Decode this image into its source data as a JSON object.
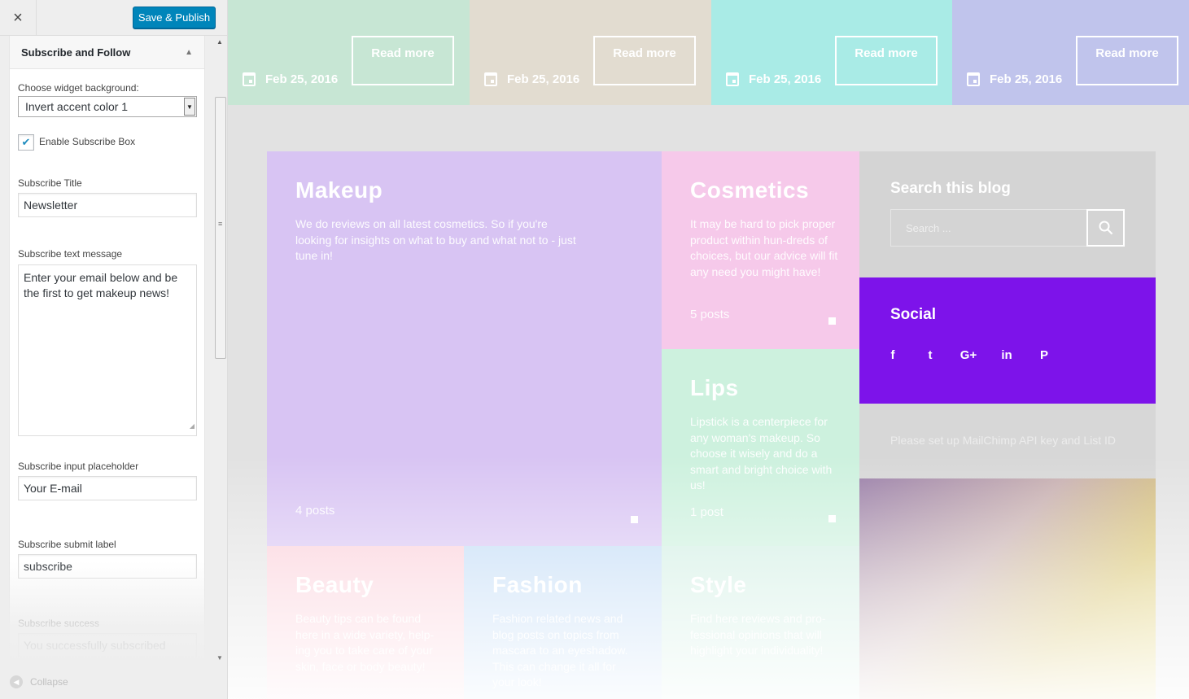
{
  "customizer": {
    "close_label": "×",
    "save_label": "Save & Publish",
    "section_title": "Subscribe and Follow",
    "section_arrow": "▲",
    "widget_background_label": "Choose widget background:",
    "widget_background_value": "Invert accent color 1",
    "enable_subscribe_label": "Enable Subscribe Box",
    "enable_subscribe_checked": true,
    "subscribe_title_label": "Subscribe Title",
    "subscribe_title_value": "Newsletter",
    "subscribe_text_label": "Subscribe text message",
    "subscribe_text_value": "Enter your email below and be the first to get makeup news!",
    "placeholder_label": "Subscribe input placeholder",
    "placeholder_value": "Your E-mail",
    "submit_label_label": "Subscribe submit label",
    "submit_label_value": "subscribe",
    "success_label": "Subscribe success",
    "success_value": "You successfully subscribed",
    "collapse_label": "Collapse"
  },
  "preview": {
    "top_posts": [
      {
        "date": "Feb 25, 2016",
        "button": "Read more",
        "color": "#c7e6d4"
      },
      {
        "date": "Feb 25, 2016",
        "button": "Read more",
        "color": "#e2dcd0"
      },
      {
        "date": "Feb 25, 2016",
        "button": "Read more",
        "color": "#a9ebe6"
      },
      {
        "date": "Feb 25, 2016",
        "button": "Read more",
        "color": "#c0c4ec"
      }
    ],
    "categories": {
      "makeup": {
        "title": "Makeup",
        "desc": "We do reviews on all latest cosmetics. So if you're looking for insights on what to buy and what not to - just tune in!",
        "count": "4 posts",
        "color": "#d8c4f3"
      },
      "cosmetics": {
        "title": "Cosmetics",
        "desc": "It may be hard to pick proper product within hun-dreds of choices, but our advice will fit any need you might have!",
        "count": "5 posts",
        "color": "#f6c9ea"
      },
      "lips": {
        "title": "Lips",
        "desc": "Lipstick is a centerpiece for any woman's makeup. So choose it wisely and do a smart and bright choice with us!",
        "count": "1 post",
        "color": "#cdf1de"
      },
      "beauty": {
        "title": "Beauty",
        "desc": "Beauty tips can be found here in a wide variety, help-ing you to take care of your skin, face or body beauty!",
        "color": "#fbd0da"
      },
      "fashion": {
        "title": "Fashion",
        "desc": "Fashion related news and blog posts on topics from mascara to an eyeshadow. This can change it all for your look!",
        "color": "#c3dcf6"
      },
      "style": {
        "title": "Style",
        "desc": "Find here reviews and pro-fessional opinions that will highlight your individuality!",
        "color": "#d2efe4"
      }
    },
    "search": {
      "title": "Search this blog",
      "placeholder": "Search ..."
    },
    "social": {
      "title": "Social",
      "icons": [
        "f",
        "t",
        "G+",
        "in",
        "P"
      ],
      "color": "#7d13ea"
    },
    "mailchimp_notice": "Please set up MailChimp API key and List ID"
  }
}
